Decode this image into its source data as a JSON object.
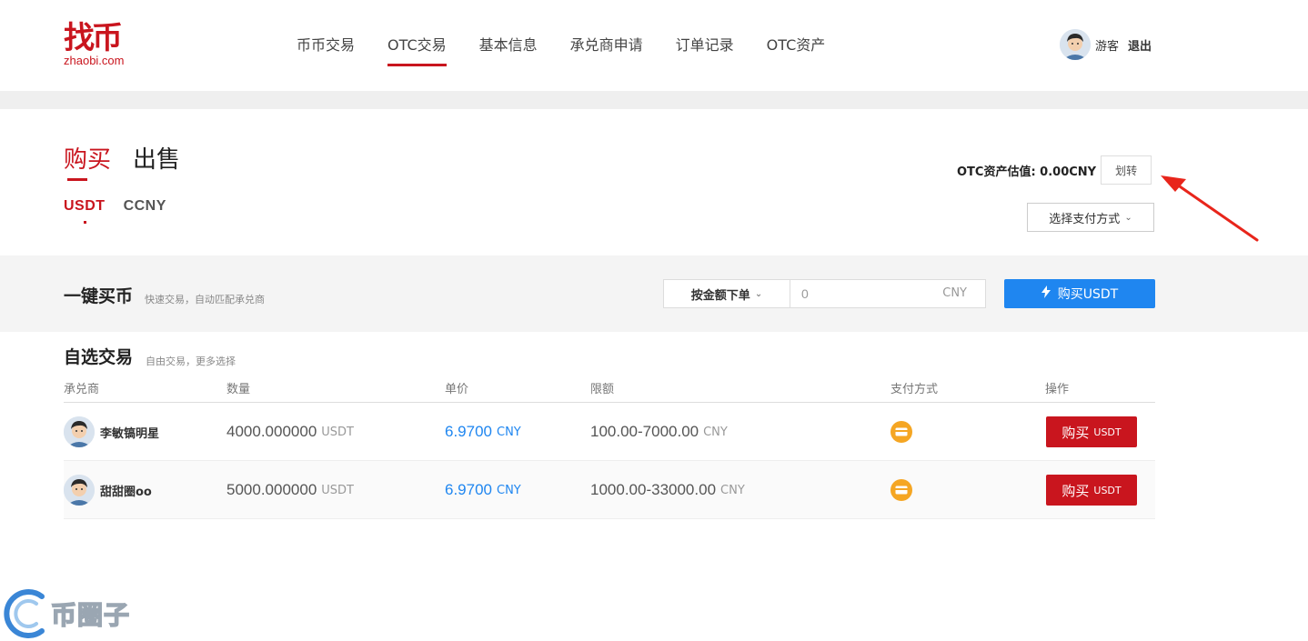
{
  "header": {
    "logo_mark": "找币",
    "logo_domain": "zhaobi.com",
    "nav": [
      {
        "label": "币币交易"
      },
      {
        "label": "OTC交易",
        "active": true
      },
      {
        "label": "基本信息"
      },
      {
        "label": "承兑商申请"
      },
      {
        "label": "订单记录"
      },
      {
        "label": "OTC资产"
      }
    ],
    "user_name": "游客",
    "logout_label": "退出"
  },
  "trade": {
    "tabs": [
      {
        "label": "购买",
        "active": true
      },
      {
        "label": "出售"
      }
    ],
    "coins": [
      {
        "label": "USDT",
        "active": true
      },
      {
        "label": "CCNY"
      }
    ],
    "asset_text": "OTC资产估值: 0.00CNY",
    "transfer_label": "划转",
    "pay_method_label": "选择支付方式"
  },
  "quick": {
    "title": "一键买币",
    "subtitle": "快速交易，自动匹配承兑商",
    "order_mode_label": "按金额下单",
    "amount_value": "0",
    "amount_unit": "CNY",
    "buy_label": "购买USDT"
  },
  "selection": {
    "title": "自选交易",
    "subtitle": "自由交易，更多选择",
    "headers": {
      "merchant": "承兑商",
      "quantity": "数量",
      "price": "单价",
      "limit": "限额",
      "payment": "支付方式",
      "action": "操作"
    },
    "rows": [
      {
        "merchant": "李敏镐明星",
        "quantity": "4000.000000",
        "quantity_unit": "USDT",
        "price": "6.9700",
        "price_unit": "CNY",
        "limit": "100.00-7000.00",
        "limit_unit": "CNY",
        "payment_icon": "bank-card-icon",
        "buy_label": "购买",
        "buy_unit": "USDT"
      },
      {
        "merchant": "甜甜圈oo",
        "quantity": "5000.000000",
        "quantity_unit": "USDT",
        "price": "6.9700",
        "price_unit": "CNY",
        "limit": "1000.00-33000.00",
        "limit_unit": "CNY",
        "payment_icon": "bank-card-icon",
        "buy_label": "购买",
        "buy_unit": "USDT"
      }
    ]
  },
  "watermark_text": "币圈子",
  "colors": {
    "brand_red": "#c9151e",
    "action_blue": "#1f86f0",
    "payment_orange": "#f5a623"
  }
}
